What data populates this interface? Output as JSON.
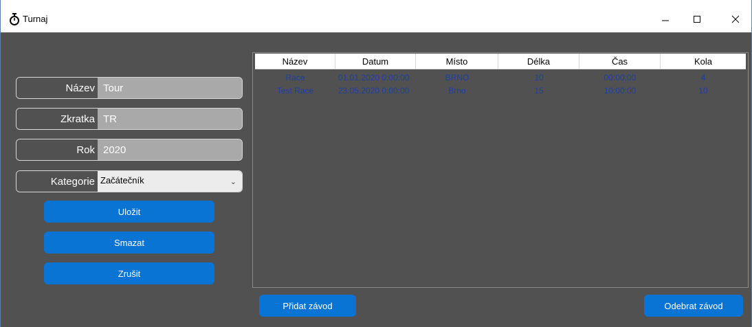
{
  "window": {
    "title": "Turnaj"
  },
  "form": {
    "name_label": "Název",
    "name_value": "Tour",
    "abbr_label": "Zkratka",
    "abbr_value": "TR",
    "year_label": "Rok",
    "year_value": "2020",
    "category_label": "Kategorie",
    "category_value": "Začátečník"
  },
  "buttons": {
    "save": "Uložit",
    "delete": "Smazat",
    "cancel": "Zrušit",
    "add_race": "Přidat závod",
    "remove_race": "Odebrat závod"
  },
  "table": {
    "columns": [
      "Název",
      "Datum",
      "Místo",
      "Délka",
      "Čas",
      "Kola"
    ],
    "rows": [
      [
        "Race",
        "01.01.2020 0:00:00",
        "BRNO",
        "10",
        "00:00:00",
        "4"
      ],
      [
        "Test Race",
        "23.05.2020 0:00:00",
        "Brno",
        "15",
        "10:00:00",
        "10"
      ]
    ]
  },
  "colors": {
    "background": "#515151",
    "accent": "#0a74d4",
    "row_text": "#1e3fa0",
    "input_bg": "#a9a9a9"
  }
}
